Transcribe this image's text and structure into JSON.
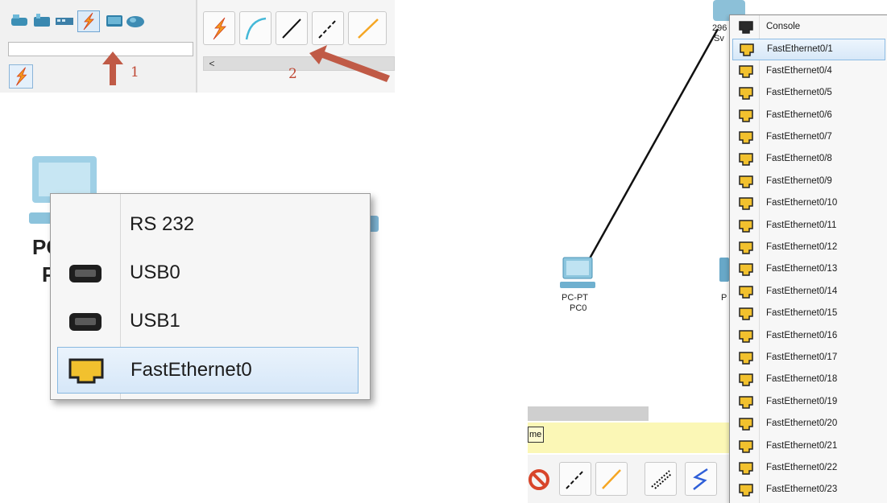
{
  "toolbar": {
    "annotations": [
      "1",
      "2"
    ],
    "scroll_left_glyph": "<"
  },
  "pc_menu": {
    "device_label_top": "PC",
    "device_label_bottom": "P",
    "items": [
      {
        "label": "RS 232",
        "icon": "none"
      },
      {
        "label": "USB0",
        "icon": "usb-port-icon"
      },
      {
        "label": "USB1",
        "icon": "usb-port-icon"
      },
      {
        "label": "FastEthernet0",
        "icon": "ethernet-port-icon",
        "selected": true
      }
    ]
  },
  "switch_view": {
    "switch_label_a": "296",
    "switch_label_b": "Sv",
    "pc0_type": "PC-PT",
    "pc0_name": "PC0",
    "pc1_fragment": "P",
    "status_fragment": "me",
    "port_menu": [
      {
        "label": "Console",
        "icon": "console-port-icon"
      },
      {
        "label": "FastEthernet0/1",
        "icon": "ethernet-port-icon",
        "selected": true
      },
      {
        "label": "FastEthernet0/4",
        "icon": "ethernet-port-icon"
      },
      {
        "label": "FastEthernet0/5",
        "icon": "ethernet-port-icon"
      },
      {
        "label": "FastEthernet0/6",
        "icon": "ethernet-port-icon"
      },
      {
        "label": "FastEthernet0/7",
        "icon": "ethernet-port-icon"
      },
      {
        "label": "FastEthernet0/8",
        "icon": "ethernet-port-icon"
      },
      {
        "label": "FastEthernet0/9",
        "icon": "ethernet-port-icon"
      },
      {
        "label": "FastEthernet0/10",
        "icon": "ethernet-port-icon"
      },
      {
        "label": "FastEthernet0/11",
        "icon": "ethernet-port-icon"
      },
      {
        "label": "FastEthernet0/12",
        "icon": "ethernet-port-icon"
      },
      {
        "label": "FastEthernet0/13",
        "icon": "ethernet-port-icon"
      },
      {
        "label": "FastEthernet0/14",
        "icon": "ethernet-port-icon"
      },
      {
        "label": "FastEthernet0/15",
        "icon": "ethernet-port-icon"
      },
      {
        "label": "FastEthernet0/16",
        "icon": "ethernet-port-icon"
      },
      {
        "label": "FastEthernet0/17",
        "icon": "ethernet-port-icon"
      },
      {
        "label": "FastEthernet0/18",
        "icon": "ethernet-port-icon"
      },
      {
        "label": "FastEthernet0/19",
        "icon": "ethernet-port-icon"
      },
      {
        "label": "FastEthernet0/20",
        "icon": "ethernet-port-icon"
      },
      {
        "label": "FastEthernet0/21",
        "icon": "ethernet-port-icon"
      },
      {
        "label": "FastEthernet0/22",
        "icon": "ethernet-port-icon"
      },
      {
        "label": "FastEthernet0/23",
        "icon": "ethernet-port-icon"
      }
    ]
  },
  "colors": {
    "annotation_red": "#c04a36",
    "port_yellow": "#f2c12e",
    "selection_blue": "#d6e7f8",
    "status_yellow": "#fbf7b6"
  }
}
